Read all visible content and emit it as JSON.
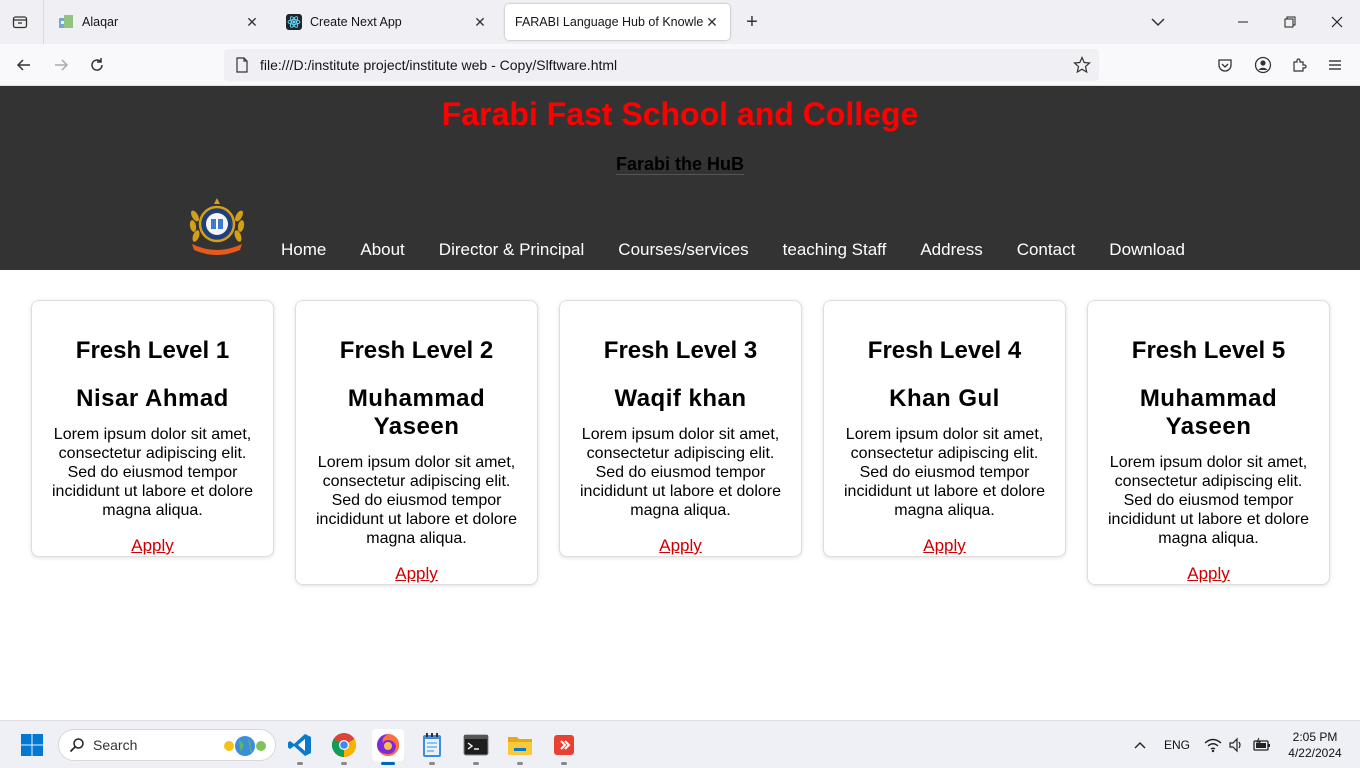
{
  "browser": {
    "tabs": [
      {
        "title": "Alaqar",
        "active": false
      },
      {
        "title": "Create Next App",
        "active": false
      },
      {
        "title": "FARABI Language Hub of Knowledge",
        "active": true
      }
    ],
    "url": "file:///D:/institute project/institute web - Copy/Slftware.html"
  },
  "site": {
    "title": "Farabi Fast School and College",
    "subtitle": "Farabi the HuB",
    "menu": [
      "Home",
      "About",
      "Director & Principal",
      "Courses/services",
      "teaching Staff",
      "Address",
      "Contact",
      "Download"
    ]
  },
  "cards": [
    {
      "level": "Fresh Level 1",
      "name": "Nisar Ahmad",
      "text": "Lorem ipsum dolor sit amet, consectetur adipiscing elit. Sed do eiusmod tempor incididunt ut labore et dolore magna aliqua.",
      "link": "Apply"
    },
    {
      "level": "Fresh Level 2",
      "name": "Muhammad Yaseen",
      "text": "Lorem ipsum dolor sit amet, consectetur adipiscing elit. Sed do eiusmod tempor incididunt ut labore et dolore magna aliqua.",
      "link": "Apply"
    },
    {
      "level": "Fresh Level 3",
      "name": "Waqif khan",
      "text": "Lorem ipsum dolor sit amet, consectetur adipiscing elit. Sed do eiusmod tempor incididunt ut labore et dolore magna aliqua.",
      "link": "Apply"
    },
    {
      "level": "Fresh Level 4",
      "name": "Khan Gul",
      "text": "Lorem ipsum dolor sit amet, consectetur adipiscing elit. Sed do eiusmod tempor incididunt ut labore et dolore magna aliqua.",
      "link": "Apply"
    },
    {
      "level": "Fresh Level 5",
      "name": "Muhammad Yaseen",
      "text": "Lorem ipsum dolor sit amet, consectetur adipiscing elit. Sed do eiusmod tempor incididunt ut labore et dolore magna aliqua.",
      "link": "Apply"
    }
  ],
  "taskbar": {
    "search_label": "Search",
    "language": "ENG",
    "time": "2:05 PM",
    "date": "4/22/2024",
    "apps": [
      "vscode-icon",
      "chrome-icon",
      "firefox-icon",
      "notepad-icon",
      "terminal-icon",
      "file-explorer-icon",
      "git-icon"
    ]
  },
  "colors": {
    "header_bg": "#333333",
    "title_red": "#ff0000",
    "link_red": "#cc0000"
  }
}
